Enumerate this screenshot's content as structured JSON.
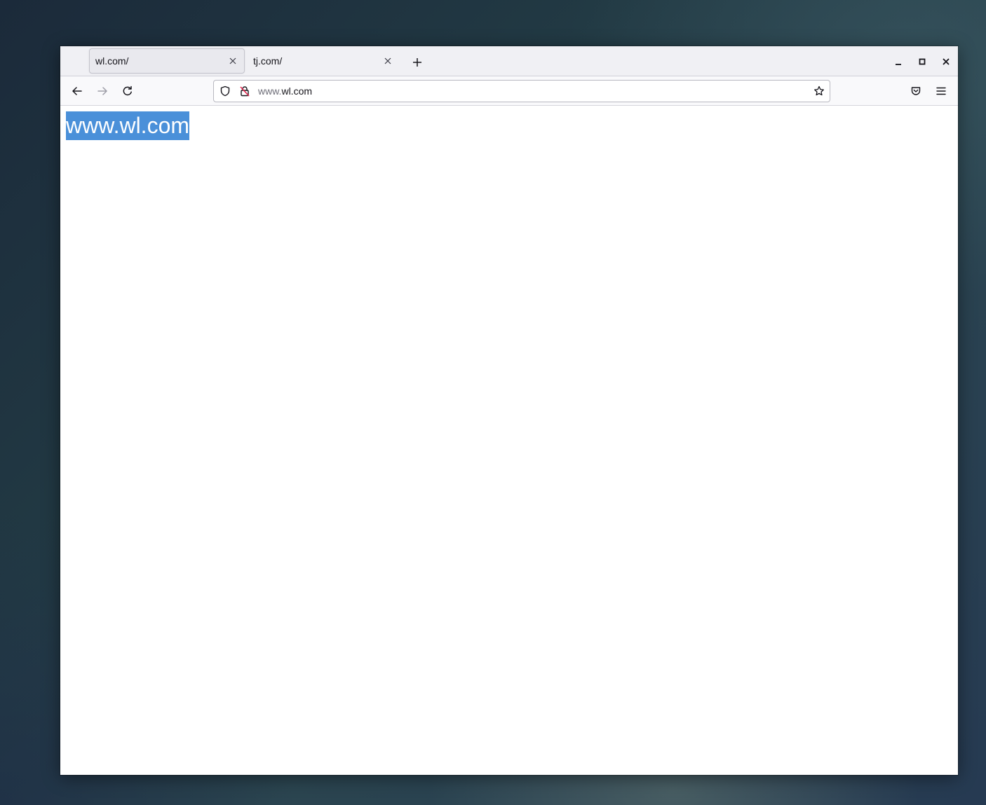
{
  "browser": {
    "tabs": [
      {
        "title": "wl.com/",
        "active": true
      },
      {
        "title": "tj.com/",
        "active": false
      }
    ],
    "url": {
      "prefix": "www.",
      "domain": "wl.com"
    }
  },
  "page": {
    "heading": "www.wl.com",
    "selection_color": "#4a90d9"
  },
  "icons": {
    "tab_close": "close-icon",
    "new_tab": "plus-icon",
    "minimize": "minimize-icon",
    "maximize": "maximize-icon",
    "close_window": "close-icon",
    "back": "back-arrow-icon",
    "forward": "forward-arrow-icon",
    "reload": "reload-icon",
    "tracking_protection": "shield-icon",
    "insecure_connection": "lock-insecure-icon",
    "bookmark": "star-icon",
    "pocket": "pocket-icon",
    "menu": "hamburger-menu-icon"
  }
}
